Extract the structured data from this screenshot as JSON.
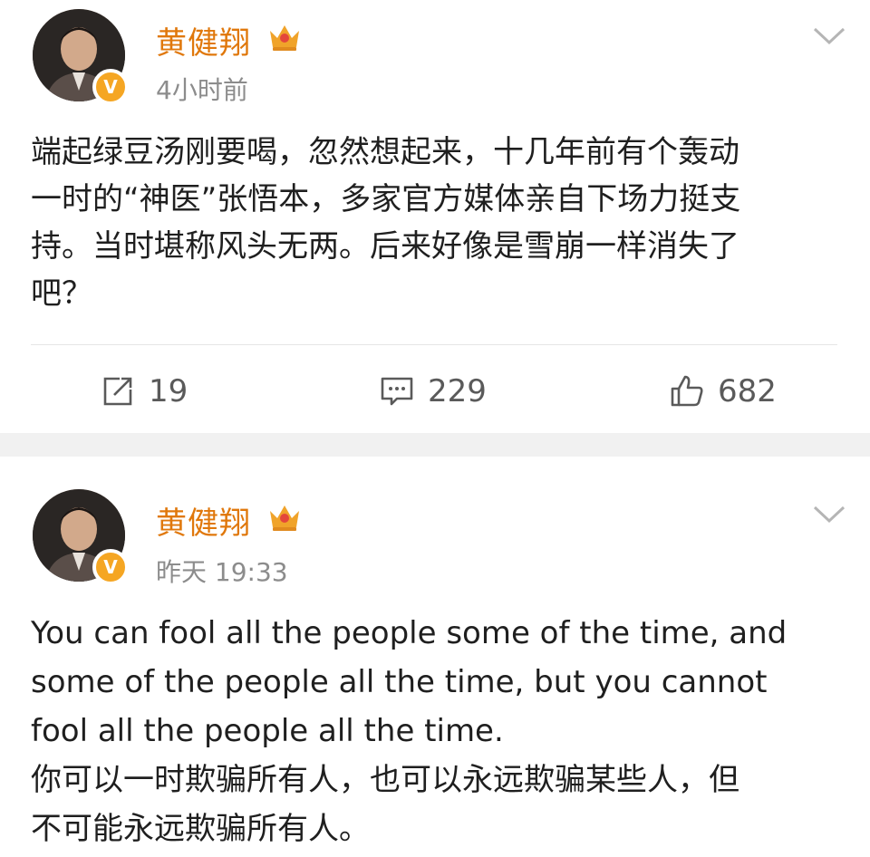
{
  "posts": [
    {
      "author": "黄健翔",
      "time": "4小时前",
      "content": [
        "端起绿豆汤刚要喝，忽然想起来，十几年前有个轰动",
        "一时的“神医”张悟本，多家官方媒体亲自下场力挺支",
        "持。当时堪称风头无两。后来好像是雪崩一样消失了",
        "吧？"
      ],
      "reposts": "19",
      "comments": "229",
      "likes": "682"
    },
    {
      "author": "黄健翔",
      "time": "昨天 19:33",
      "content": [
        "You can fool all the people some of the time, and",
        "some of the people all the time, but you cannot",
        "fool all the people all the time.",
        "你可以一时欺骗所有人，也可以永远欺骗某些人，但",
        "不可能永远欺骗所有人。"
      ]
    }
  ],
  "colors": {
    "author": "#e0780c",
    "badge": "#f5a623",
    "muted": "#8c8c8c",
    "icon": "#5a5a5a"
  },
  "icons": {
    "verified": "verified-v-badge",
    "member": "crown-icon",
    "menu": "chevron-down-icon",
    "repost": "repost-icon",
    "comment": "comment-icon",
    "like": "thumbs-up-icon"
  }
}
